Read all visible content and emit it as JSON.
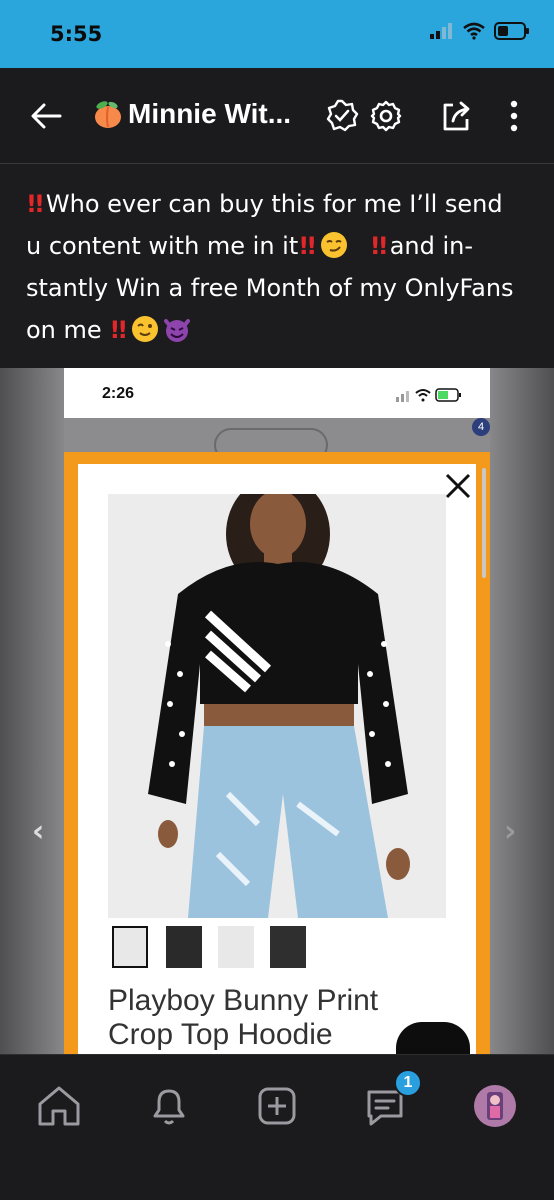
{
  "status_bar": {
    "time": "5:55"
  },
  "header": {
    "title": "Minnie Wit..."
  },
  "post": {
    "line1": "Who ever can buy this for me I’ll send",
    "line2a": "u content with me in it",
    "line3": "stantly Win a free Month of my OnlyFans",
    "line2b": "and in-",
    "line4": "on me"
  },
  "embedded_screenshot": {
    "time": "2:26",
    "cart_count": "4",
    "product_title_line1": "Playboy Bunny Print",
    "product_title_line2": "Crop Top Hoodie"
  },
  "bottom_nav": {
    "messages_badge": "1"
  },
  "colors": {
    "status_bar": "#2aa6dd",
    "background": "#1c1c1e",
    "accent_orange": "#f39a1d",
    "badge_blue": "#2a9fe0",
    "alert_red": "#e3262a"
  }
}
